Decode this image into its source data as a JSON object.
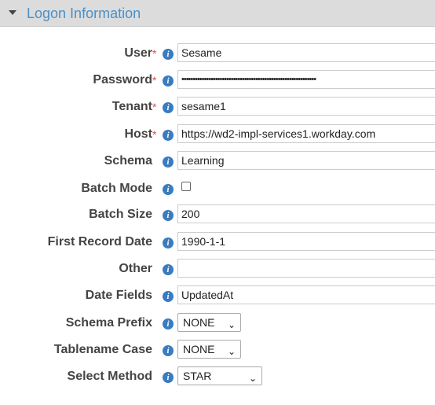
{
  "section": {
    "title": "Logon Information"
  },
  "fields": [
    {
      "label": "User",
      "required": "*",
      "value": "Sesame"
    },
    {
      "label": "Password",
      "required": "*",
      "value": "••••••••••••••••••••••••••••••••••••••••••••••••••••••••••••"
    },
    {
      "label": "Tenant",
      "required": "*",
      "value": "sesame1"
    },
    {
      "label": "Host",
      "required": "*",
      "value": "https://wd2-impl-services1.workday.com"
    },
    {
      "label": "Schema",
      "value": "Learning"
    },
    {
      "label": "Batch Mode",
      "checked": false
    },
    {
      "label": "Batch Size",
      "value": "200"
    },
    {
      "label": "First Record Date",
      "value": "1990-1-1"
    },
    {
      "label": "Other",
      "value": ""
    },
    {
      "label": "Date Fields",
      "value": "UpdatedAt"
    },
    {
      "label": "Schema Prefix",
      "value": "NONE"
    },
    {
      "label": "Tablename Case",
      "value": "NONE"
    },
    {
      "label": "Select Method",
      "value": "STAR"
    }
  ],
  "icons": {
    "info": "i",
    "dropdown": "⌄"
  }
}
